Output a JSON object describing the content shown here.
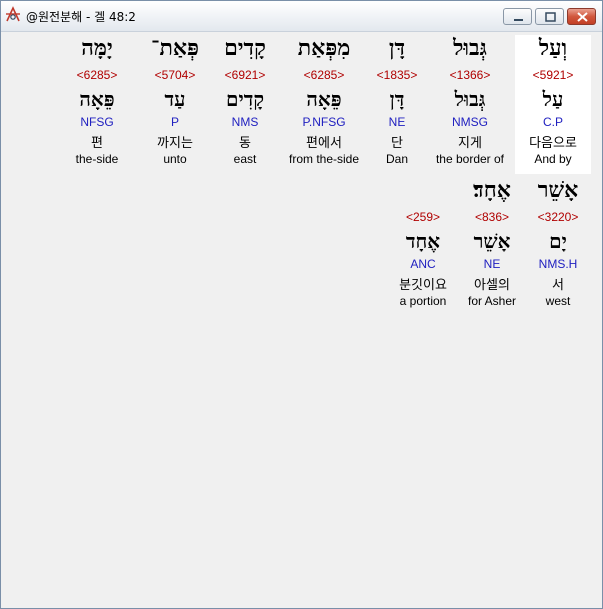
{
  "window": {
    "title": "@원전분해 - 겔 48:2"
  },
  "line1": [
    {
      "hebrew": "וְעַל",
      "strong": "<5921>",
      "lemma": "עַל",
      "morph": "C.P",
      "korean": "다음으로",
      "english": "And by",
      "highlight": true
    },
    {
      "hebrew": "גְּבוּל",
      "strong": "<1366>",
      "lemma": "גְּבוּל",
      "morph": "NMSG",
      "korean": "지게",
      "english": "the border of",
      "highlight": false
    },
    {
      "hebrew": "דָּן",
      "strong": "<1835>",
      "lemma": "דָּן",
      "morph": "NE",
      "korean": "단",
      "english": "Dan",
      "highlight": false
    },
    {
      "hebrew": "מִפְּאַת",
      "strong": "<6285>",
      "lemma": "פֵּאָה",
      "morph": "P.NFSG",
      "korean": "편에서",
      "english": "from the-side",
      "highlight": false
    },
    {
      "hebrew": "קָדִים",
      "strong": "<6921>",
      "lemma": "קָדִים",
      "morph": "NMS",
      "korean": "동",
      "english": "east",
      "highlight": false
    },
    {
      "hebrew": "פְּאַת־",
      "strong": "<5704>",
      "lemma": "עַד",
      "morph": "P",
      "korean": "까지는",
      "english": "unto",
      "highlight": false
    },
    {
      "hebrew": "יָמָּה",
      "strong": "<6285>",
      "lemma": "פֵּאָה",
      "morph": "NFSG",
      "korean": "편",
      "english": "the-side",
      "highlight": false
    }
  ],
  "line2": [
    {
      "hebrew": "אָשֵׁר",
      "strong": "<3220>",
      "lemma": "יָם",
      "morph": "NMS.H",
      "korean": "서",
      "english": "west"
    },
    {
      "hebrew": "אֶחָד׃",
      "strong": "<836>",
      "lemma": "אָשֵׁר",
      "morph": "NE",
      "korean": "아셀의",
      "english": "for Asher"
    },
    {
      "hebrew": "",
      "strong": "<259>",
      "lemma": "אֶחָד",
      "morph": "ANC",
      "korean": "분깃이요",
      "english": "a portion"
    }
  ]
}
